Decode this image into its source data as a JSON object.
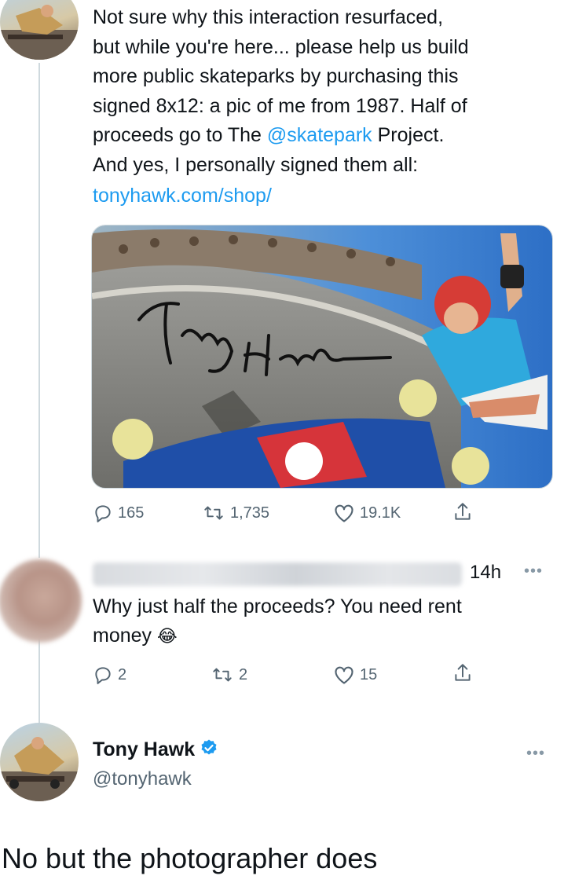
{
  "tweet1": {
    "text_before_handle": "Not sure why this interaction resurfaced,\nbut while you're here... please help us build\nmore public skateparks by purchasing this\nsigned 8x12: a pic of me from 1987. Half of\nproceeds go to The ",
    "handle_mention": "@skatepark",
    "text_after_handle": " Project.\nAnd yes, I personally signed them all:",
    "link": "tonyhawk.com/shop/",
    "media_signature": "Tony Hawk",
    "actions": {
      "replies": "165",
      "retweets": "1,735",
      "likes": "19.1K"
    }
  },
  "reply": {
    "time": "14h",
    "text": "Why just half the proceeds? You need rent",
    "text_line2": "money",
    "emoji": "😂",
    "actions": {
      "replies": "2",
      "retweets": "2",
      "likes": "15"
    }
  },
  "tweet2": {
    "name": "Tony Hawk",
    "handle": "@tonyhawk",
    "text": "No but the photographer does"
  },
  "colors": {
    "link": "#1d9bf0",
    "verified": "#1d9bf0",
    "secondary_text": "#536471"
  },
  "icons": [
    "reply-icon",
    "retweet-icon",
    "like-icon",
    "share-icon",
    "more-icon",
    "verified-badge-icon"
  ]
}
